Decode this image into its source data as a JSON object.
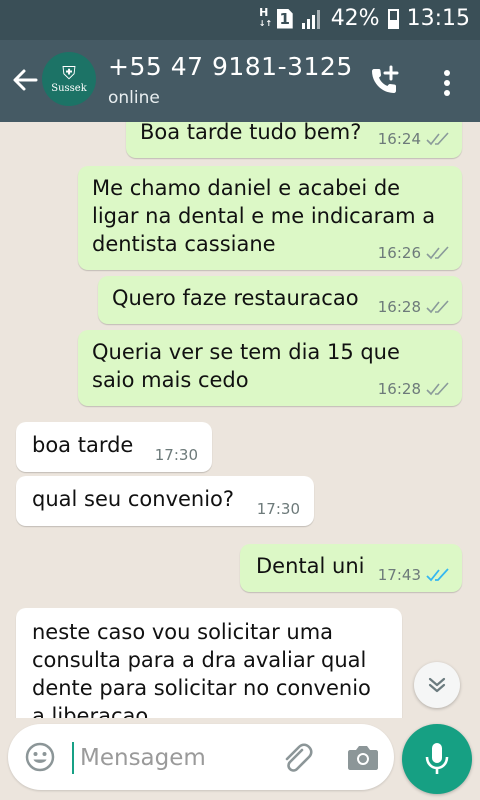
{
  "status_bar": {
    "network_label": "H",
    "sim_label": "1",
    "battery_percent": "42%",
    "time": "13:15"
  },
  "header": {
    "avatar_text": "Sussek",
    "contact_name": "+55 47 9181-3125",
    "status": "online",
    "icons": [
      "back-arrow-icon",
      "add-call-icon",
      "more-options-icon"
    ]
  },
  "messages": [
    {
      "direction": "out",
      "text": "Boa tarde tudo bem?",
      "time": "16:24",
      "ticks": "double-grey"
    },
    {
      "direction": "out",
      "text": "Me chamo daniel e acabei de\nligar na dental e me indicaram a\ndentista cassiane",
      "time": "16:26",
      "ticks": "double-grey"
    },
    {
      "direction": "out",
      "text": "Quero faze restauracao",
      "time": "16:28",
      "ticks": "double-grey"
    },
    {
      "direction": "out",
      "text": "Queria ver se tem dia 15 que\nsaio mais cedo",
      "time": "16:28",
      "ticks": "double-grey"
    },
    {
      "direction": "in",
      "text": "boa tarde",
      "time": "17:30"
    },
    {
      "direction": "in",
      "text": "qual seu convenio?",
      "time": "17:30"
    },
    {
      "direction": "out",
      "text": "Dental uni",
      "time": "17:43",
      "ticks": "double-blue"
    },
    {
      "direction": "in",
      "text": "neste caso vou solicitar uma\nconsulta para a dra avaliar qual\ndente para solicitar no convenio\na liberacao",
      "time": ""
    }
  ],
  "composer": {
    "placeholder": "Mensagem",
    "icons": [
      "emoji-icon",
      "attach-icon",
      "camera-icon",
      "mic-icon",
      "scroll-down-icon"
    ]
  },
  "colors": {
    "status_bar": "#3a4f57",
    "app_bar": "#455a64",
    "outgoing_bubble": "#dcf8c6",
    "incoming_bubble": "#ffffff",
    "accent": "#16a083",
    "read_tick": "#34b7f1",
    "chat_background": "#ece5dd"
  }
}
